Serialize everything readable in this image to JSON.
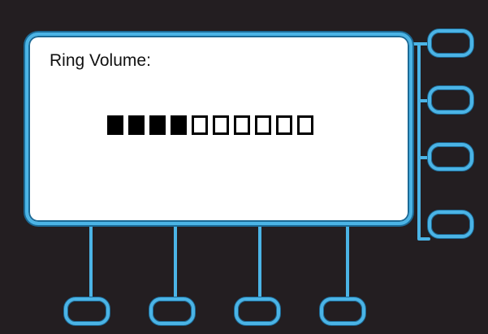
{
  "display": {
    "title": "Ring Volume:"
  },
  "ring_volume": {
    "level": 4,
    "max": 10
  },
  "colors": {
    "background": "#231e21",
    "accent": "#4bb4e6",
    "screen": "#ffffff",
    "segment": "#000000"
  }
}
